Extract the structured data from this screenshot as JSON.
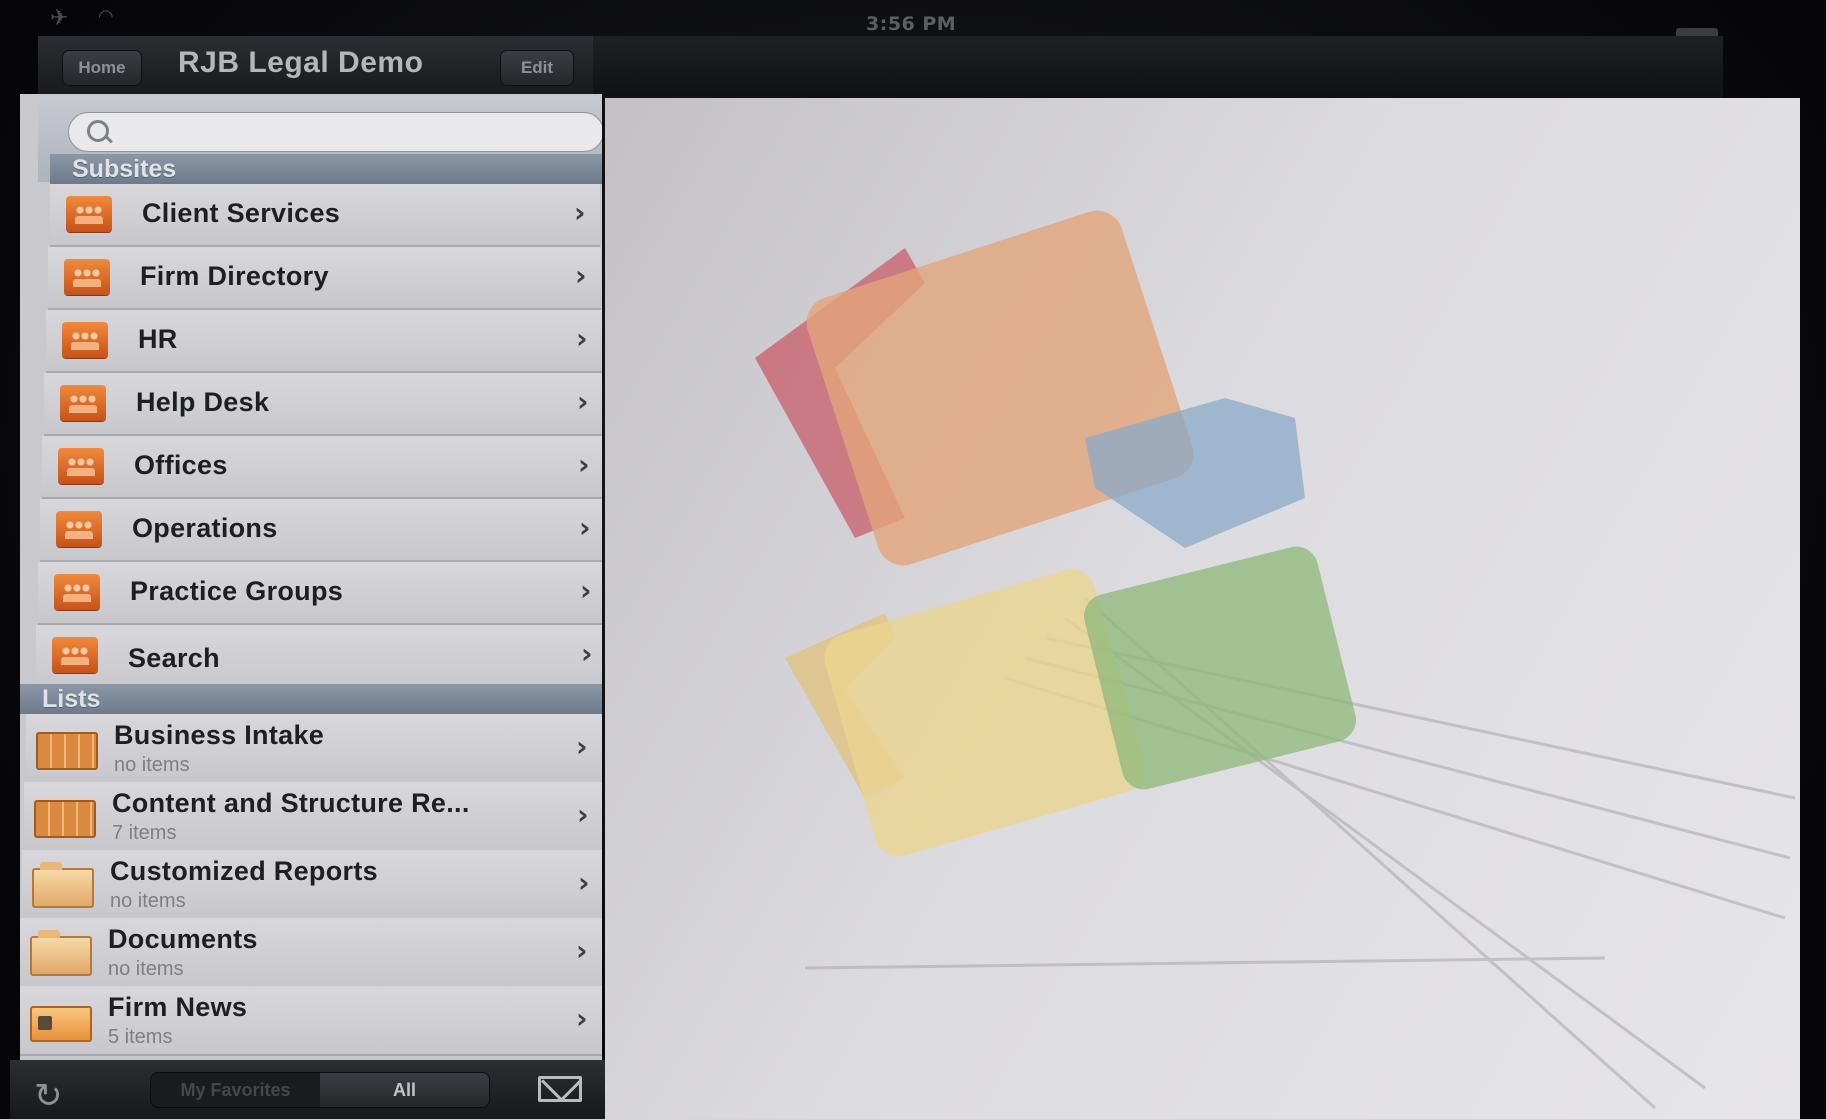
{
  "status_bar": {
    "time": "3:56 PM",
    "airplane_icon": "airplane-icon",
    "wifi_icon": "wifi-icon",
    "battery_icon": "battery-icon"
  },
  "navbar": {
    "home_label": "Home",
    "title": "RJB Legal Demo",
    "edit_label": "Edit"
  },
  "search": {
    "placeholder": "",
    "icon": "search-icon"
  },
  "subsites": {
    "header": "Subsites",
    "items": [
      {
        "label": "Client Services"
      },
      {
        "label": "Firm Directory"
      },
      {
        "label": "HR"
      },
      {
        "label": "Help Desk"
      },
      {
        "label": "Offices"
      },
      {
        "label": "Operations"
      },
      {
        "label": "Practice Groups"
      },
      {
        "label": "Search"
      }
    ]
  },
  "lists": {
    "header": "Lists",
    "items": [
      {
        "label": "Business Intake",
        "count": "no items",
        "icon": "list-icon"
      },
      {
        "label": "Content and Structure Re...",
        "count": "7 items",
        "icon": "list-icon"
      },
      {
        "label": "Customized Reports",
        "count": "no items",
        "icon": "folder-icon"
      },
      {
        "label": "Documents",
        "count": "no items",
        "icon": "folder-icon"
      },
      {
        "label": "Firm News",
        "count": "5 items",
        "icon": "news-icon"
      }
    ]
  },
  "bottom_bar": {
    "refresh_icon": "refresh-icon",
    "favorites_label": "My Favorites",
    "all_label": "All",
    "mail_icon": "mail-icon",
    "selected": "All"
  },
  "colors": {
    "accent_orange": "#e0702a",
    "section_header": "#7d8a9b",
    "chrome_dark": "#1f2125"
  }
}
